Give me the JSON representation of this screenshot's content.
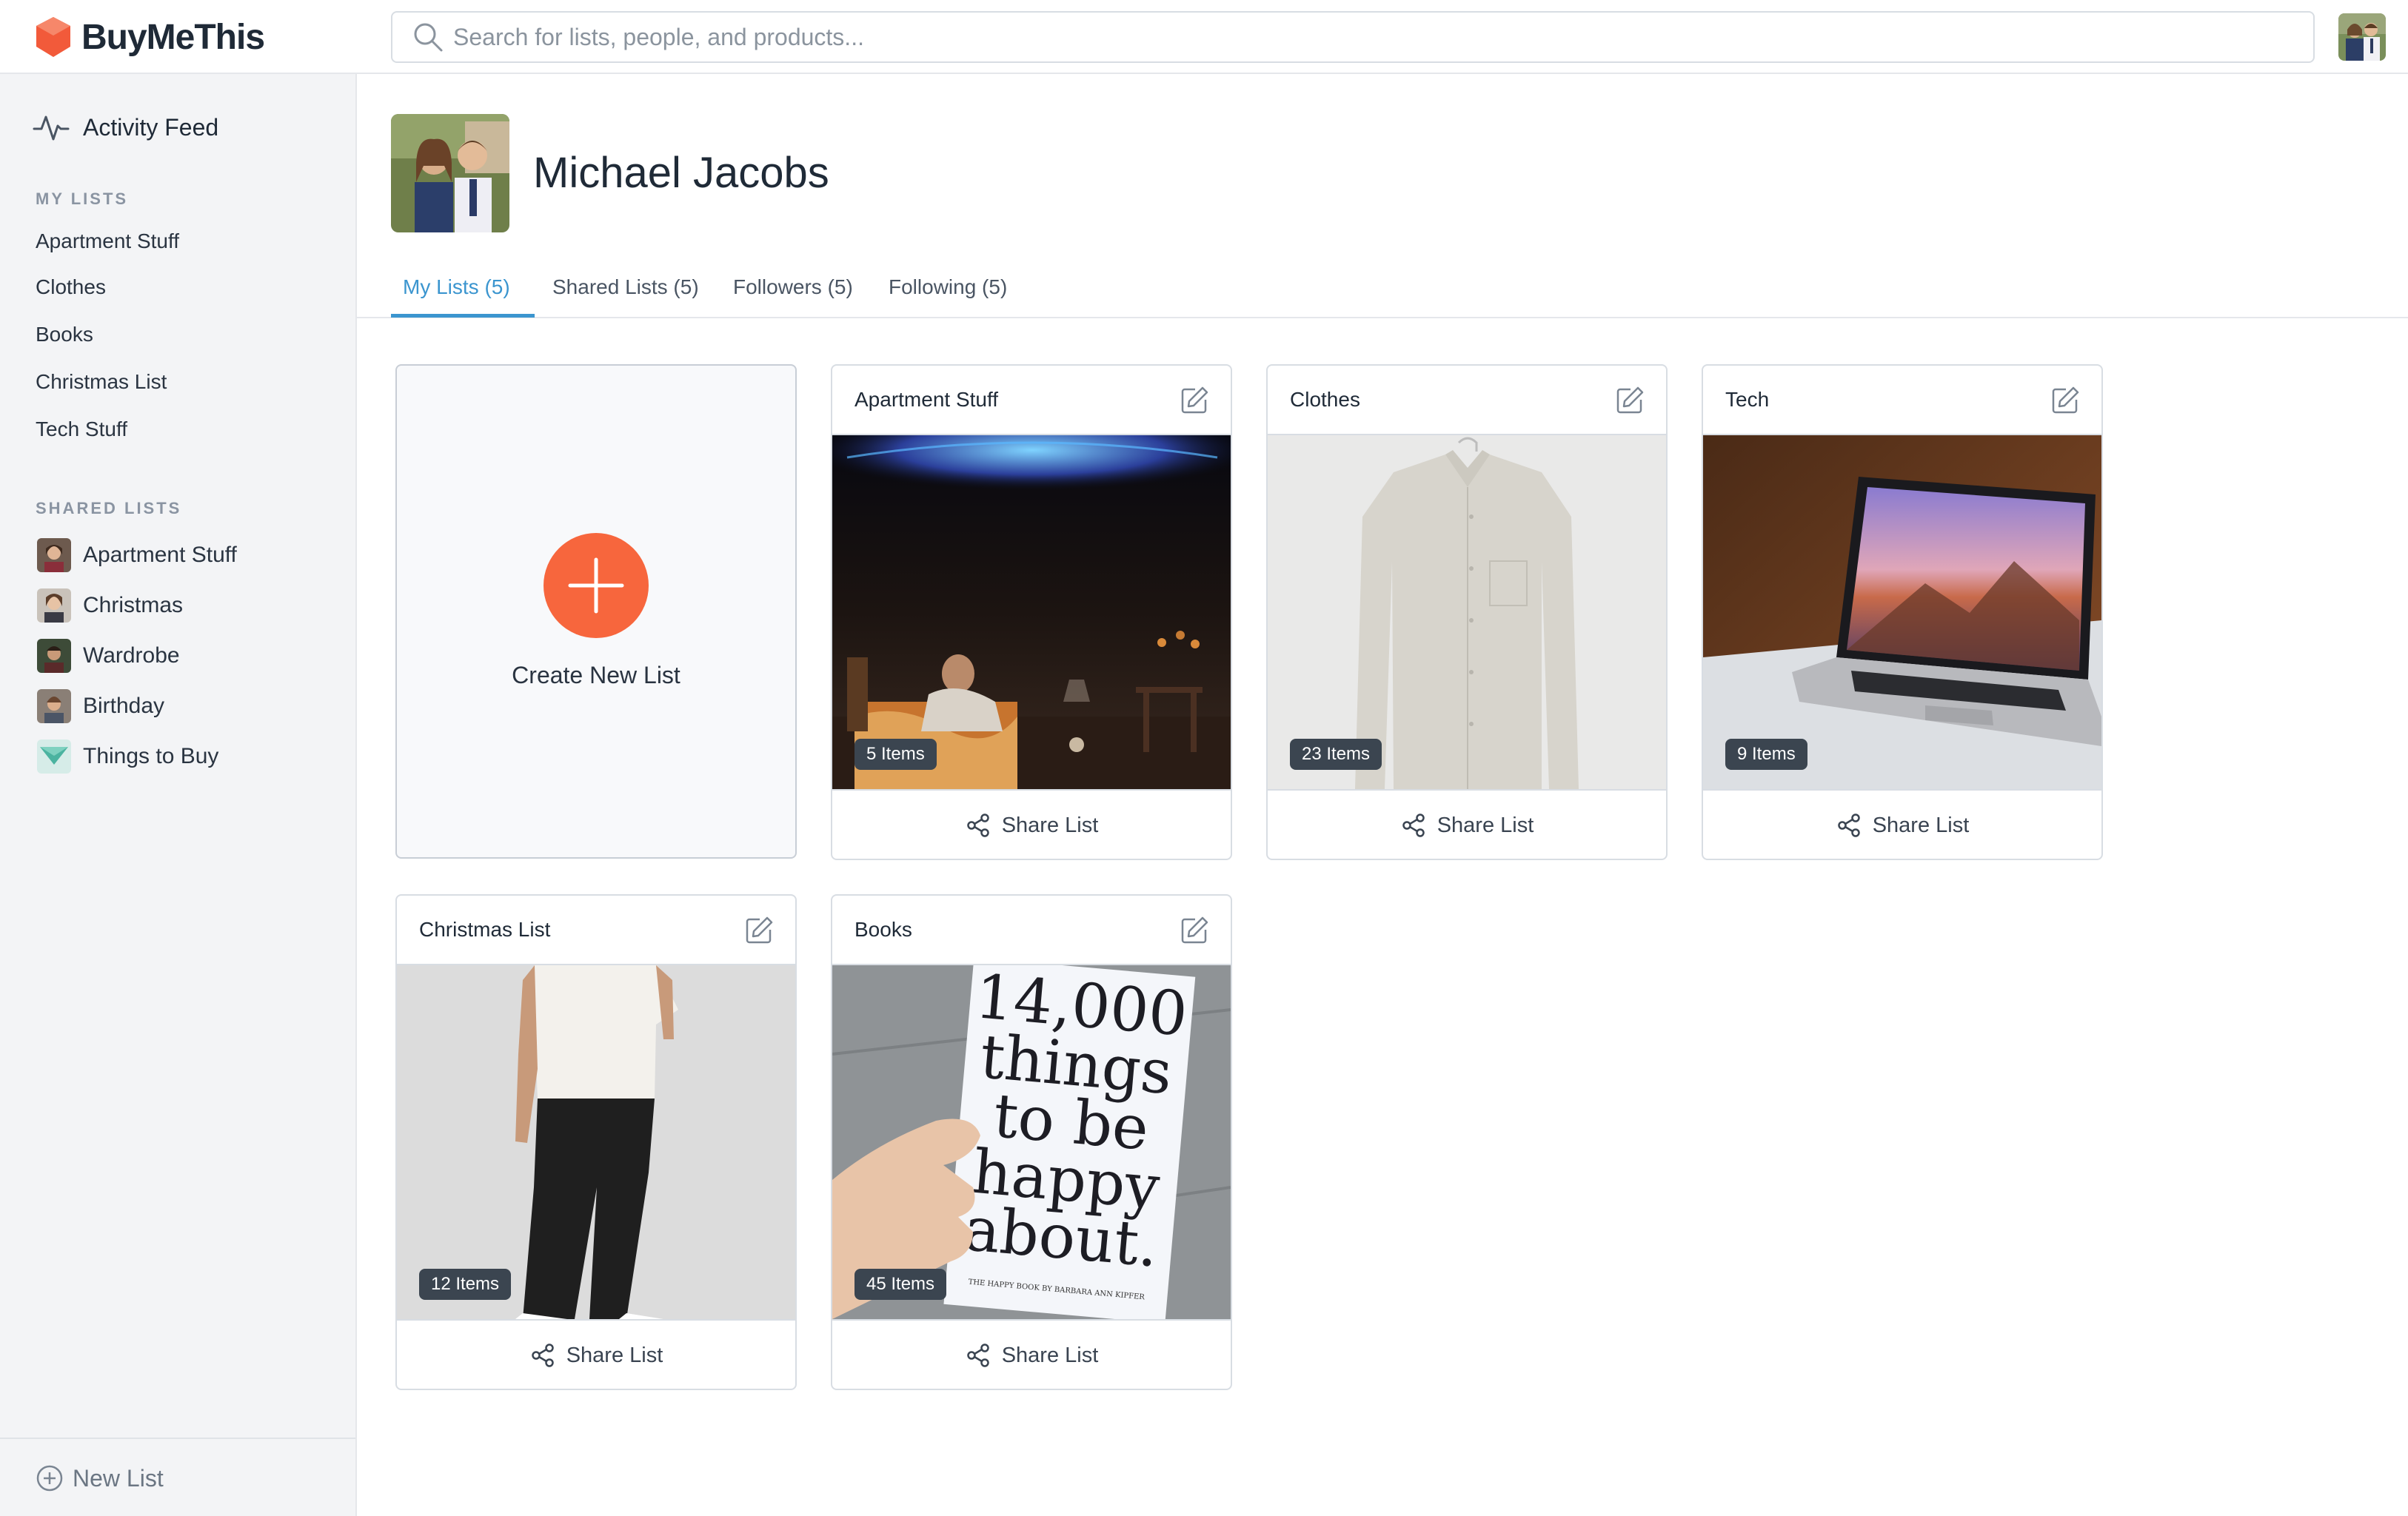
{
  "app": {
    "name": "BuyMeThis",
    "brand_color": "#f25a3a",
    "accent_color": "#3b95cf"
  },
  "search": {
    "placeholder": "Search for lists, people, and products..."
  },
  "sidebar": {
    "activity_feed": "Activity Feed",
    "my_lists_header": "MY LISTS",
    "my_lists": [
      "Apartment Stuff",
      "Clothes",
      "Books",
      "Christmas List",
      "Tech Stuff"
    ],
    "shared_lists_header": "SHARED LISTS",
    "shared_lists": [
      "Apartment Stuff",
      "Christmas",
      "Wardrobe",
      "Birthday",
      "Things to Buy"
    ],
    "new_list": "New List"
  },
  "profile": {
    "name": "Michael Jacobs",
    "tabs": [
      "My Lists (5)",
      "Shared Lists (5)",
      "Followers (5)",
      "Following (5)"
    ],
    "active_tab": "My Lists (5)"
  },
  "create_card": {
    "label": "Create New List"
  },
  "lists": [
    {
      "title": "Apartment Stuff",
      "items": "5 Items",
      "share": "Share List",
      "image": "dark-bedroom-projector"
    },
    {
      "title": "Clothes",
      "items": "23 Items",
      "share": "Share List",
      "image": "linen-shirt-on-hanger"
    },
    {
      "title": "Tech",
      "items": "9 Items",
      "share": "Share List",
      "image": "laptop-on-marble"
    },
    {
      "title": "Christmas List",
      "items": "12 Items",
      "share": "Share List",
      "image": "man-white-tee-black-pants"
    },
    {
      "title": "Books",
      "items": "45 Items",
      "share": "Share List",
      "image": "book-14000-things-to-be-happy-about",
      "book_cover": {
        "lines": [
          "14,000",
          "things",
          "to be",
          "happy",
          "about."
        ],
        "byline": "THE HAPPY BOOK BY BARBARA ANN KIPFER"
      }
    }
  ]
}
